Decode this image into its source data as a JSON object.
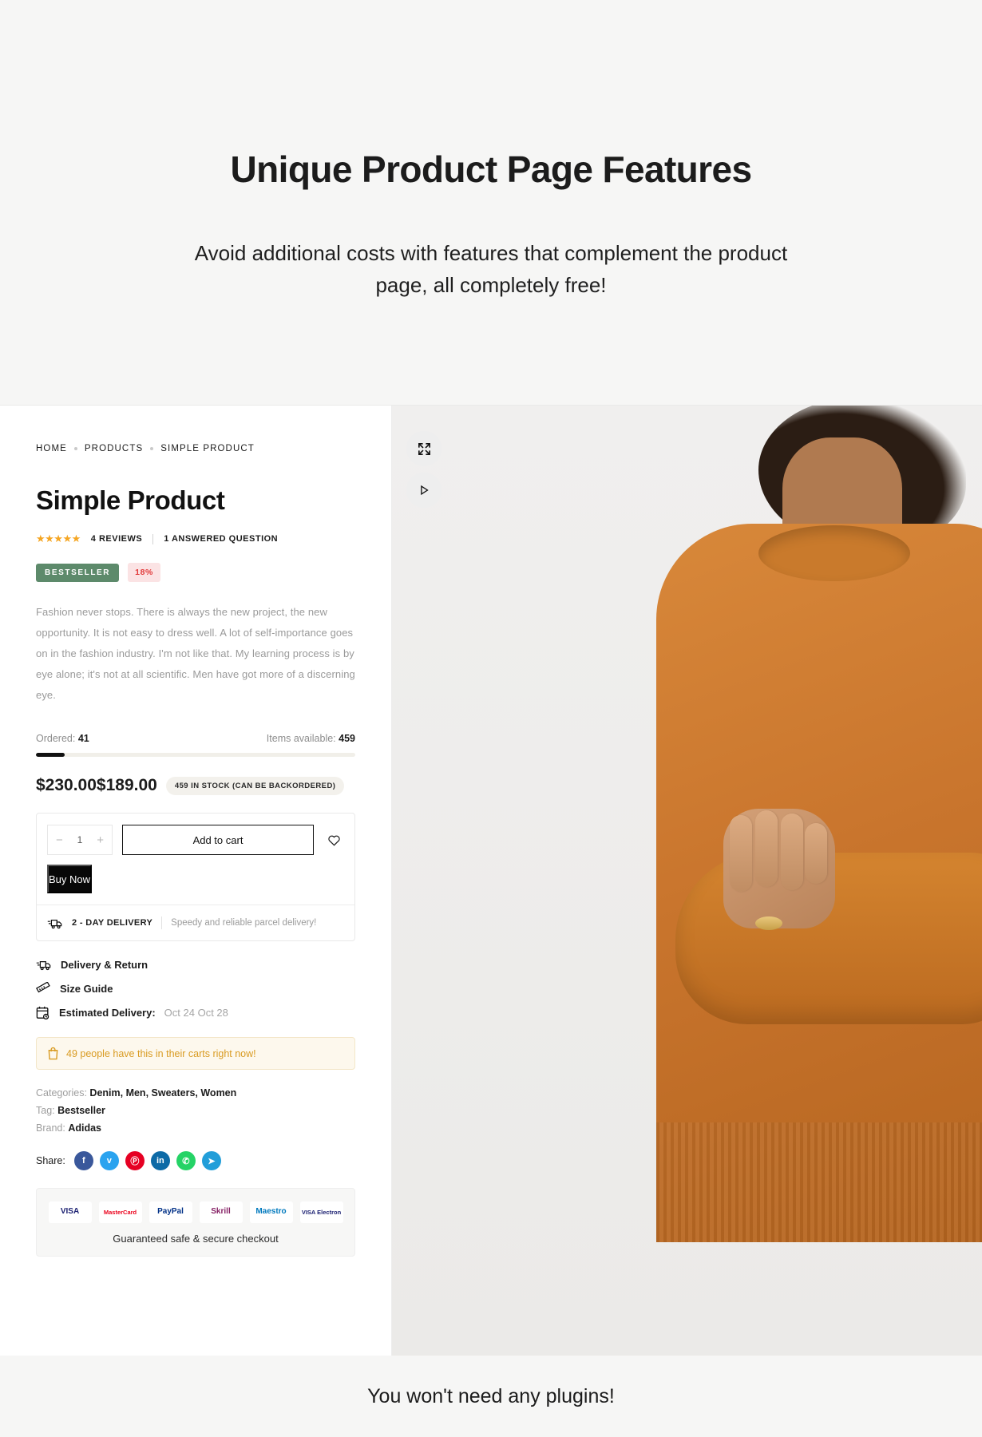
{
  "hero": {
    "title": "Unique Product Page Features",
    "subtitle": "Avoid additional costs with features that complement the product page, all completely free!"
  },
  "breadcrumb": [
    {
      "label": "HOME"
    },
    {
      "label": "PRODUCTS"
    },
    {
      "label": "SIMPLE PRODUCT"
    }
  ],
  "product": {
    "title": "Simple Product",
    "stars": "★★★★★",
    "reviews_label": "4 REVIEWS",
    "question_label": "1 ANSWERED QUESTION",
    "badge_bestseller": "BESTSELLER",
    "badge_discount": "18%",
    "description": "Fashion never stops. There is always the new project, the new opportunity. It is not easy to dress well. A lot of self-importance goes on in the fashion industry. I'm not like that. My learning process is by eye alone; it's not at all scientific. Men have got more of a discerning eye.",
    "ordered_label": "Ordered:",
    "ordered_value": "41",
    "available_label": "Items available:",
    "available_value": "459",
    "stock_percent": 9,
    "price_old": "$230.00",
    "price_new": "$189.00",
    "stock_pill": "459 IN STOCK (CAN BE BACKORDERED)"
  },
  "buybox": {
    "minus": "−",
    "quantity": "1",
    "plus": "+",
    "add_to_cart": "Add to cart",
    "buy_now": "Buy Now",
    "delivery_label": "2 - DAY DELIVERY",
    "delivery_text": "Speedy and reliable parcel delivery!"
  },
  "links": [
    {
      "icon": "truck-icon",
      "label": "Delivery & Return",
      "value": ""
    },
    {
      "icon": "ruler-icon",
      "label": "Size Guide",
      "value": ""
    },
    {
      "icon": "calendar-clock-icon",
      "label": "Estimated Delivery:",
      "value": "Oct 24 Oct 28"
    }
  ],
  "cart_alert": {
    "icon": "shopping-bag-icon",
    "text": "49 people have this in their carts right now!"
  },
  "meta": [
    {
      "label": "Categories:",
      "value": "Denim, Men, Sweaters, Women"
    },
    {
      "label": "Tag:",
      "value": "Bestseller"
    },
    {
      "label": "Brand:",
      "value": "Adidas"
    }
  ],
  "share": {
    "label": "Share:",
    "networks": [
      {
        "name": "facebook-icon",
        "glyph": "f",
        "color": "#3a589b"
      },
      {
        "name": "twitter-icon",
        "glyph": "ᴠ",
        "color": "#2aa3ef"
      },
      {
        "name": "pinterest-icon",
        "glyph": "Ⓟ",
        "color": "#e60023"
      },
      {
        "name": "linkedin-icon",
        "glyph": "in",
        "color": "#0d6aa6"
      },
      {
        "name": "whatsapp-icon",
        "glyph": "✆",
        "color": "#25d366"
      },
      {
        "name": "telegram-icon",
        "glyph": "➤",
        "color": "#229ed9"
      }
    ]
  },
  "payments": {
    "logos": [
      {
        "name": "visa-logo",
        "text": "VISA",
        "color": "#1a1f71"
      },
      {
        "name": "mastercard-logo",
        "text": "MasterCard",
        "color": "#eb001b"
      },
      {
        "name": "paypal-logo",
        "text": "PayPal",
        "color": "#003087"
      },
      {
        "name": "skrill-logo",
        "text": "Skrill",
        "color": "#862165"
      },
      {
        "name": "maestro-logo",
        "text": "Maestro",
        "color": "#0079be"
      },
      {
        "name": "visa-electron-logo",
        "text": "VISA Electron",
        "color": "#1a1f71"
      }
    ],
    "note": "Guaranteed safe & secure checkout"
  },
  "media": {
    "expand_icon": "expand-icon",
    "play_icon": "play-icon"
  },
  "footer": {
    "text": "You won't need any plugins!"
  }
}
